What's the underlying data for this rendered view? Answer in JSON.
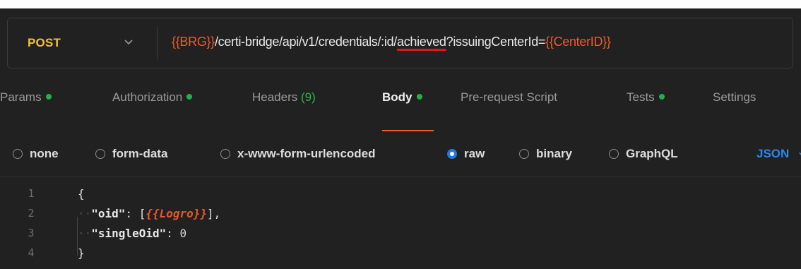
{
  "request": {
    "method": "POST",
    "url": {
      "base_var": "{{BRG}}",
      "path_prefix": "/certi-bridge/api/v1/credentials/:id/",
      "path_highlight": "achieved",
      "query": "?issuingCenterId=",
      "query_var": "{{CenterID}}"
    }
  },
  "tabs": [
    {
      "label": "Params",
      "indicator": "dot"
    },
    {
      "label": "Authorization",
      "indicator": "dot"
    },
    {
      "label": "Headers",
      "count": "(9)"
    },
    {
      "label": "Body",
      "indicator": "dot",
      "active": true
    },
    {
      "label": "Pre-request Script"
    },
    {
      "label": "Tests",
      "indicator": "dot"
    },
    {
      "label": "Settings"
    }
  ],
  "body_types": {
    "options": [
      "none",
      "form-data",
      "x-www-form-urlencoded",
      "raw",
      "binary",
      "GraphQL"
    ],
    "selected": "raw",
    "format": "JSON"
  },
  "editor": {
    "line_numbers": [
      "1",
      "2",
      "3",
      "4"
    ],
    "line1": "{",
    "line2_key": "\"oid\"",
    "line2_colon": ": ",
    "line2_open": "[",
    "line2_var": "{{Logro}}",
    "line2_close": "],",
    "line3_key": "\"singleOid\"",
    "line3_colon": ": ",
    "line3_value": "0",
    "line4": "}"
  },
  "colors": {
    "accent": "#ee5a32",
    "method": "#f2c237",
    "status_dot": "#22b04b",
    "link_blue": "#2a87f0",
    "panel_bg": "#212121"
  },
  "icons": {
    "method_dropdown": "chevron-down-icon",
    "format_dropdown": "chevron-down-icon"
  }
}
